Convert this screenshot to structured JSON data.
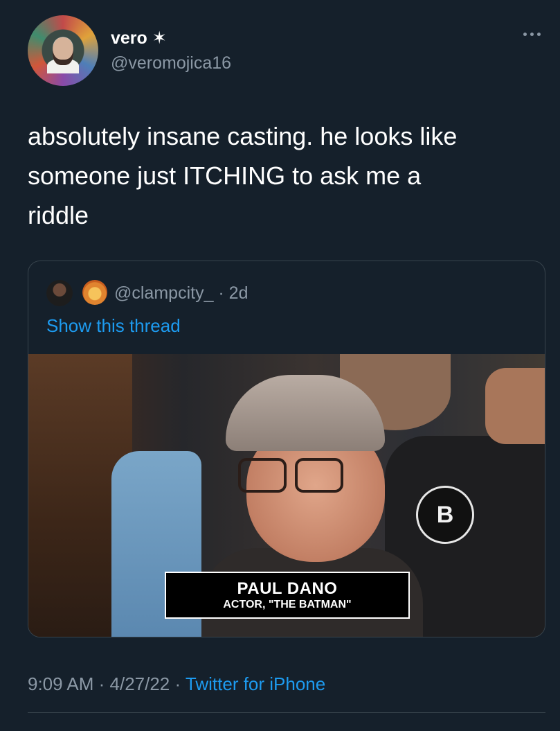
{
  "author": {
    "display_name": "vero ✶",
    "handle": "@veromojica16"
  },
  "tweet": {
    "text": "absolutely insane casting. he looks like\nsomeone just ITCHING to ask me a\nriddle"
  },
  "quoted": {
    "handle_time": "@clampcity_ · 2d",
    "show_thread": "Show this thread",
    "media": {
      "caption_name": "PAUL DANO",
      "caption_title": "ACTOR, \"THE BATMAN\"",
      "badge_letter": "B"
    }
  },
  "footer": {
    "time": "9:09 AM",
    "sep1": " · ",
    "date": "4/27/22",
    "sep2": " · ",
    "source": "Twitter for iPhone"
  },
  "colors": {
    "background": "#15202b",
    "link": "#1d9bf0",
    "secondary_text": "#8b98a5",
    "border": "#38444d"
  }
}
